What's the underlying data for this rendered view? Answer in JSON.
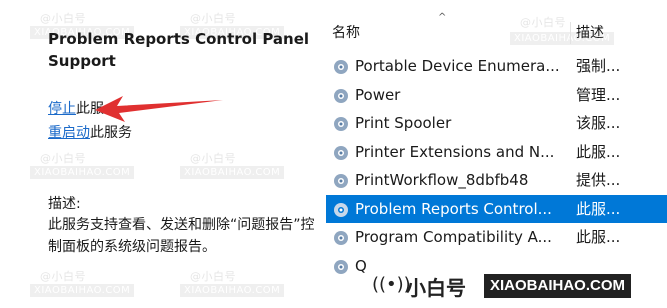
{
  "left_panel": {
    "service_title": "Problem Reports Control Panel Support",
    "stop_link": "停止",
    "stop_suffix": "此服",
    "restart_link": "重启动",
    "restart_suffix": "此服务",
    "description_label": "描述:",
    "description_text": "此服务支持查看、发送和删除“问题报告”控制面板的系统级问题报告。"
  },
  "list": {
    "column_name": "名称",
    "column_desc": "描述",
    "rows": [
      {
        "name": "Portable Device Enumera...",
        "desc": "强制..."
      },
      {
        "name": "Power",
        "desc": "管理..."
      },
      {
        "name": "Print Spooler",
        "desc": "该服..."
      },
      {
        "name": "Printer Extensions and N...",
        "desc": "此服..."
      },
      {
        "name": "PrintWorkflow_8dbfb48",
        "desc": "提供..."
      },
      {
        "name": "Problem Reports Control...",
        "desc": "此服...",
        "selected": true
      },
      {
        "name": "Program Compatibility A...",
        "desc": "此服..."
      }
    ],
    "partial_row_name": "Q"
  },
  "watermark": {
    "cn": "@小白号",
    "en": "XIAOBAIHAO.COM",
    "logo_cn": "小白号",
    "logo_en": "XIAOBAIHAO.COM"
  },
  "colors": {
    "selection": "#0078d7",
    "link": "#1b6ac9",
    "arrow": "#e03030"
  }
}
